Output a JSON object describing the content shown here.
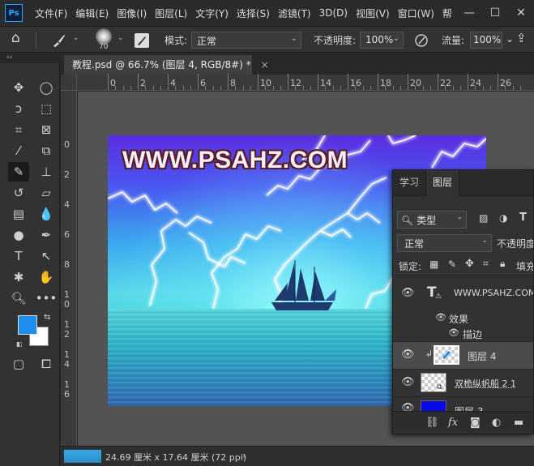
{
  "menubar": {
    "logo": "Ps",
    "items": [
      "文件(F)",
      "编辑(E)",
      "图像(I)",
      "图层(L)",
      "文字(Y)",
      "选择(S)",
      "滤镜(T)",
      "3D(D)",
      "视图(V)",
      "窗口(W)",
      "帮"
    ],
    "window_controls": [
      "—",
      "☐",
      "✕"
    ]
  },
  "options": {
    "brush_size": "70",
    "mode_label": "模式:",
    "mode_value": "正常",
    "opacity_label": "不透明度:",
    "opacity_value": "100%",
    "flow_label": "流量:",
    "flow_value": "100%"
  },
  "toolbar": {
    "collapse_glyph": "‹‹",
    "fg_color": "#1e8ff0",
    "bg_color": "#ffffff"
  },
  "document": {
    "tab_title": "教程.psd @ 66.7% (图层 4, RGB/8#) *",
    "tab_close": "×"
  },
  "ruler": {
    "top_labels": [
      "0",
      "2",
      "4",
      "6",
      "8",
      "10",
      "12",
      "14",
      "16",
      "18",
      "20",
      "22",
      "24",
      "26"
    ],
    "left_labels": [
      "0",
      "2",
      "4",
      "6",
      "8",
      "1\n0",
      "1\n2",
      "1\n4",
      "1\n6"
    ]
  },
  "canvas": {
    "title_text": "WWW.PSAHZ.COM"
  },
  "status": {
    "dimensions": "24.69 厘米 x 17.64 厘米 (72 ppi)",
    "arrow": "›"
  },
  "layers_panel": {
    "tabs": [
      "学习",
      "图层"
    ],
    "filter_label": "类型",
    "blend_mode": "正常",
    "opacity_label": "不透明度",
    "lock_label": "锁定:",
    "fill_label": "填充",
    "layers": [
      {
        "name": "WWW.PSAHZ.COM",
        "type": "text"
      },
      {
        "name": "效果",
        "type": "effects"
      },
      {
        "name": "描边",
        "type": "effect"
      },
      {
        "name": "图层 4",
        "type": "pixel",
        "selected": true
      },
      {
        "name": "双桅纵帆船 2 1",
        "type": "smart"
      },
      {
        "name": "图层 3",
        "type": "pixel"
      }
    ]
  }
}
